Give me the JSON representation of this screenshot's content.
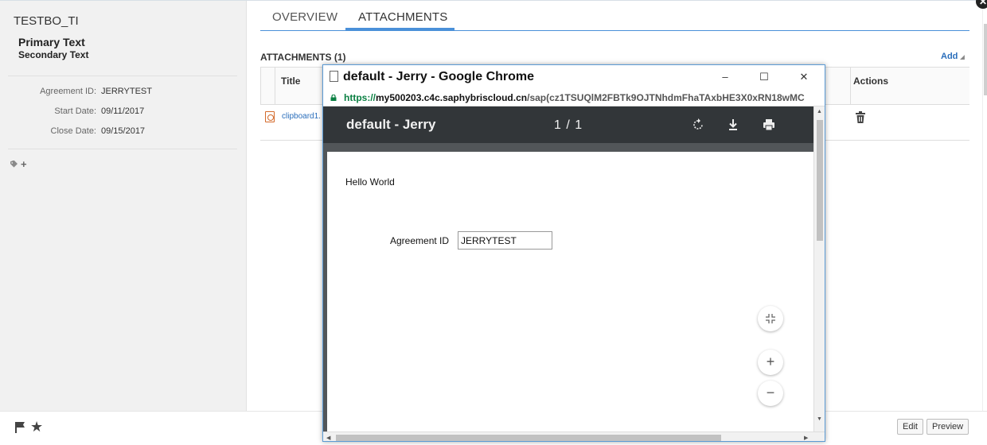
{
  "header": {
    "object_title": "TESTBO_TI",
    "primary_text": "Primary Text",
    "secondary_text": "Secondary Text"
  },
  "details": [
    {
      "label": "Agreement ID:",
      "value": "JERRYTEST"
    },
    {
      "label": "Start Date:",
      "value": "09/11/2017"
    },
    {
      "label": "Close Date:",
      "value": "09/15/2017"
    }
  ],
  "tags": {
    "add_symbol": "+",
    "icon": "tag-icon"
  },
  "tabs": [
    {
      "label": "OVERVIEW",
      "active": false
    },
    {
      "label": "ATTACHMENTS",
      "active": true
    }
  ],
  "attachments": {
    "heading": "ATTACHMENTS (1)",
    "add_label": "Add",
    "columns": [
      "Title",
      "Actions"
    ],
    "rows": [
      {
        "title": "clipboard1.",
        "file_icon": "pdf-file-icon",
        "action_icon": "trash-icon"
      }
    ]
  },
  "footer": {
    "icons": [
      "flag-icon",
      "star-icon"
    ],
    "edit_label": "Edit",
    "preview_label": "Preview"
  },
  "popup": {
    "window_title": "default - Jerry - Google Chrome",
    "url_scheme": "https://",
    "url_host": "my500203.c4c.saphybriscloud.cn",
    "url_path": "/sap(cz1TSUQlM2FBTk9OJTNhdmFhaTAxbHE3X0xRN18wMC",
    "window_controls": {
      "minimize": "–",
      "maximize": "☐",
      "close": "✕"
    },
    "pdf_viewer": {
      "document_name": "default - Jerry",
      "page_indicator": "1 / 1",
      "toolbar_icons": [
        "rotate-icon",
        "download-icon",
        "print-icon"
      ],
      "page_text": "Hello World",
      "field_label": "Agreement ID",
      "field_value": "JERRYTEST",
      "fit_icon": "fit-page-icon",
      "zoom_in": "+",
      "zoom_out": "−"
    }
  }
}
